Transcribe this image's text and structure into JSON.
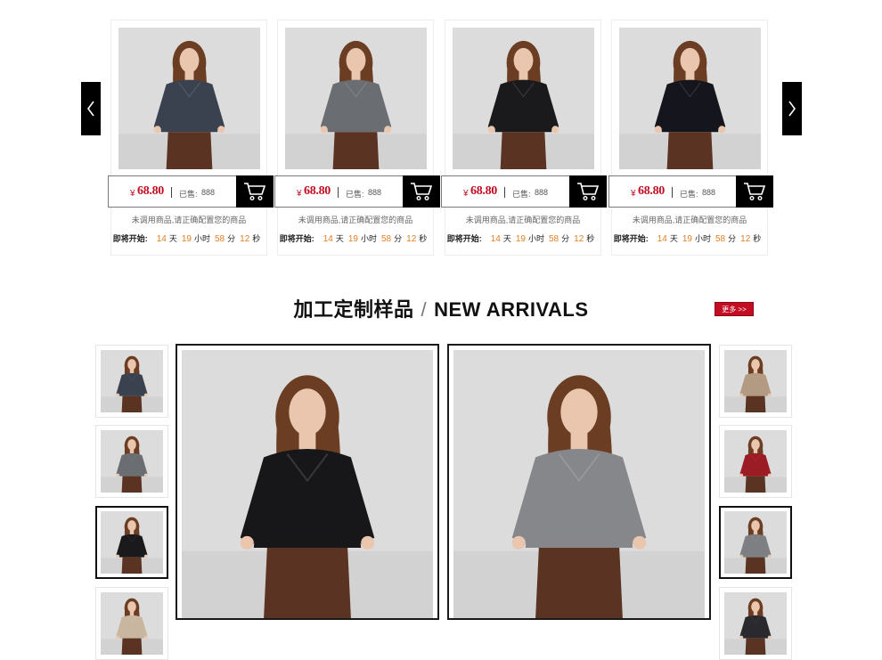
{
  "carousel": {
    "products": [
      {
        "currency": "¥",
        "price": "68.80",
        "sold_label": "已售:",
        "sold_value": "888",
        "note": "未调用商品,请正确配置您的商品",
        "timer": {
          "label": "即将开始:",
          "days": "14",
          "days_unit": "天",
          "hours": "19",
          "hours_unit": "小时",
          "minutes": "58",
          "minutes_unit": "分",
          "seconds": "12",
          "seconds_unit": "秒"
        },
        "sweater_color": "#3a4250"
      },
      {
        "currency": "¥",
        "price": "68.80",
        "sold_label": "已售:",
        "sold_value": "888",
        "note": "未调用商品,请正确配置您的商品",
        "timer": {
          "label": "即将开始:",
          "days": "14",
          "days_unit": "天",
          "hours": "19",
          "hours_unit": "小时",
          "minutes": "58",
          "minutes_unit": "分",
          "seconds": "12",
          "seconds_unit": "秒"
        },
        "sweater_color": "#6a6d72"
      },
      {
        "currency": "¥",
        "price": "68.80",
        "sold_label": "已售:",
        "sold_value": "888",
        "note": "未调用商品,请正确配置您的商品",
        "timer": {
          "label": "即将开始:",
          "days": "14",
          "days_unit": "天",
          "hours": "19",
          "hours_unit": "小时",
          "minutes": "58",
          "minutes_unit": "分",
          "seconds": "12",
          "seconds_unit": "秒"
        },
        "sweater_color": "#1a1a1c"
      },
      {
        "currency": "¥",
        "price": "68.80",
        "sold_label": "已售:",
        "sold_value": "888",
        "note": "未调用商品,请正确配置您的商品",
        "timer": {
          "label": "即将开始:",
          "days": "14",
          "days_unit": "天",
          "hours": "19",
          "hours_unit": "小时",
          "minutes": "58",
          "minutes_unit": "分",
          "seconds": "12",
          "seconds_unit": "秒"
        },
        "sweater_color": "#15161d"
      }
    ],
    "prev_icon": "chevron-left-icon",
    "next_icon": "chevron-right-icon"
  },
  "section": {
    "title_cn": "加工定制样品",
    "separator": "/",
    "title_en": "NEW ARRIVALS",
    "more_label": "更多 >>"
  },
  "gallery": {
    "left_thumbs": [
      {
        "sweater_color": "#3a4250"
      },
      {
        "sweater_color": "#6a6d72"
      },
      {
        "sweater_color": "#1a1a1c",
        "active": true
      },
      {
        "sweater_color": "#c9b6a0"
      }
    ],
    "right_thumbs": [
      {
        "sweater_color": "#b39a82"
      },
      {
        "sweater_color": "#9b1c24"
      },
      {
        "sweater_color": "#7d7f82",
        "active": true
      },
      {
        "sweater_color": "#2a2a2e"
      }
    ],
    "main_left": {
      "sweater_color": "#17171a"
    },
    "main_right": {
      "sweater_color": "#85878a"
    }
  },
  "colors": {
    "accent_red": "#c30d23",
    "countdown_orange": "#e67e22",
    "cart_black": "#000000"
  }
}
